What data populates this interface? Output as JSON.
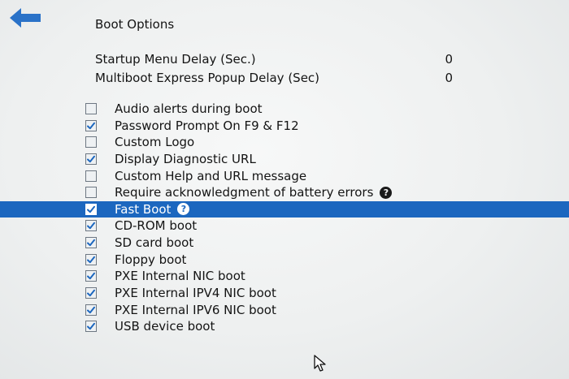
{
  "header": {
    "title": "Boot Options"
  },
  "delays": [
    {
      "label": "Startup Menu Delay (Sec.)",
      "value": "0"
    },
    {
      "label": "Multiboot Express Popup Delay (Sec)",
      "value": "0"
    }
  ],
  "options": [
    {
      "label": "Audio alerts during boot",
      "checked": false,
      "help": false,
      "selected": false
    },
    {
      "label": "Password Prompt On F9 & F12",
      "checked": true,
      "help": false,
      "selected": false
    },
    {
      "label": "Custom Logo",
      "checked": false,
      "help": false,
      "selected": false
    },
    {
      "label": "Display Diagnostic URL",
      "checked": true,
      "help": false,
      "selected": false
    },
    {
      "label": "Custom Help and URL message",
      "checked": false,
      "help": false,
      "selected": false
    },
    {
      "label": "Require acknowledgment of battery errors",
      "checked": false,
      "help": true,
      "selected": false
    },
    {
      "label": "Fast Boot",
      "checked": true,
      "help": true,
      "selected": true
    },
    {
      "label": "CD-ROM boot",
      "checked": true,
      "help": false,
      "selected": false
    },
    {
      "label": "SD card boot",
      "checked": true,
      "help": false,
      "selected": false
    },
    {
      "label": "Floppy boot",
      "checked": true,
      "help": false,
      "selected": false
    },
    {
      "label": "PXE Internal NIC boot",
      "checked": true,
      "help": false,
      "selected": false
    },
    {
      "label": "PXE Internal IPV4 NIC boot",
      "checked": true,
      "help": false,
      "selected": false
    },
    {
      "label": "PXE Internal IPV6 NIC boot",
      "checked": true,
      "help": false,
      "selected": false
    },
    {
      "label": "USB device boot",
      "checked": true,
      "help": false,
      "selected": false
    }
  ],
  "help_icon_glyph": "?",
  "colors": {
    "accent": "#1c67bf",
    "back_arrow": "#2a72c8"
  },
  "icons": {
    "back": "back-arrow-icon",
    "help": "help-icon",
    "cursor": "mouse-pointer-icon"
  }
}
